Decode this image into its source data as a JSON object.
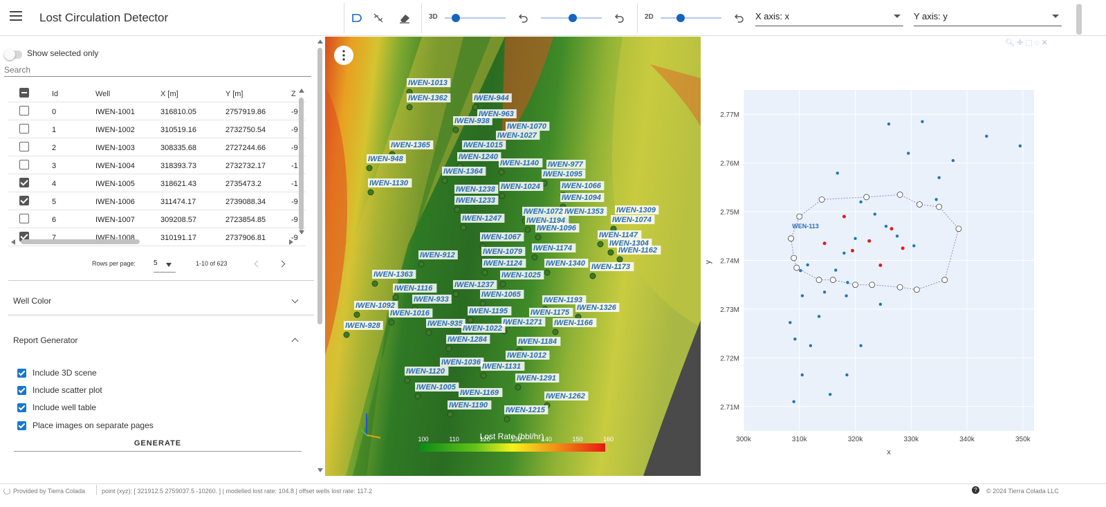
{
  "app": {
    "title": "Lost Circulation Detector"
  },
  "toolbar": {
    "label_3d": "3D",
    "label_2d": "2D",
    "slider_3d_a": 0.18,
    "slider_3d_b": 0.52,
    "slider_2d": 0.33,
    "x_axis": "X axis: x",
    "y_axis": "Y axis: y"
  },
  "sidebar": {
    "show_selected_label": "Show selected only",
    "search_placeholder": "Search",
    "columns": [
      "Id",
      "Well",
      "X [m]",
      "Y [m]",
      "Z"
    ],
    "rows": [
      {
        "id": "0",
        "well": "IWEN-1001",
        "x": "316810.05",
        "y": "2757919.86",
        "z": "-9",
        "sel": false
      },
      {
        "id": "1",
        "well": "IWEN-1002",
        "x": "310519.16",
        "y": "2732750.54",
        "z": "-9",
        "sel": false
      },
      {
        "id": "2",
        "well": "IWEN-1003",
        "x": "308335.68",
        "y": "2727244.66",
        "z": "-9",
        "sel": false
      },
      {
        "id": "3",
        "well": "IWEN-1004",
        "x": "318393.73",
        "y": "2732732.17",
        "z": "-1",
        "sel": false
      },
      {
        "id": "4",
        "well": "IWEN-1005",
        "x": "318621.43",
        "y": "2735473.2",
        "z": "-1",
        "sel": true
      },
      {
        "id": "5",
        "well": "IWEN-1006",
        "x": "311474.17",
        "y": "2739088.34",
        "z": "-9",
        "sel": true
      },
      {
        "id": "6",
        "well": "IWEN-1007",
        "x": "309208.57",
        "y": "2723854.85",
        "z": "-9",
        "sel": false
      },
      {
        "id": "7",
        "well": "IWEN-1008",
        "x": "310191.17",
        "y": "2737906.81",
        "z": "-9",
        "sel": true
      }
    ],
    "rows_per_page_label": "Rows per page:",
    "rows_per_page": "5",
    "range": "1-10 of 623",
    "well_color": "Well Color",
    "report_title": "Report Generator",
    "options": [
      "Include 3D scene",
      "Include scatter plot",
      "Include well table",
      "Place images on separate pages"
    ],
    "generate": "GENERATE"
  },
  "viewer": {
    "colorbar_title": "Lost Rate (bbl/hr)",
    "colorbar_ticks": [
      "100",
      "110",
      "120",
      "130",
      "140",
      "150",
      "160"
    ],
    "labels": [
      [
        "IWEN-1013",
        588,
        119
      ],
      [
        "IWEN-1362",
        588,
        141
      ],
      [
        "IWEN-944",
        683,
        141
      ],
      [
        "IWEN-963",
        690,
        164
      ],
      [
        "IWEN-938",
        655,
        174
      ],
      [
        "IWEN-1070",
        731,
        182
      ],
      [
        "IWEN-1027",
        717,
        195
      ],
      [
        "IWEN-1365",
        563,
        209
      ],
      [
        "IWEN-1015",
        668,
        209
      ],
      [
        "IWEN-948",
        530,
        229
      ],
      [
        "IWEN-1240",
        661,
        226
      ],
      [
        "IWEN-1140",
        721,
        235
      ],
      [
        "IWEN-977",
        790,
        237
      ],
      [
        "IWEN-1364",
        639,
        247
      ],
      [
        "IWEN-1095",
        783,
        251
      ],
      [
        "IWEN-1130",
        532,
        264
      ],
      [
        "IWEN-1024",
        722,
        269
      ],
      [
        "IWEN-1066",
        810,
        268
      ],
      [
        "IWEN-1238",
        657,
        273
      ],
      [
        "IWEN-1094",
        810,
        285
      ],
      [
        "IWEN-1233",
        657,
        289
      ],
      [
        "IWEN-1072",
        755,
        305
      ],
      [
        "IWEN-1353",
        814,
        305
      ],
      [
        "IWEN-1309",
        889,
        303
      ],
      [
        "IWEN-1247",
        666,
        315
      ],
      [
        "IWEN-1194",
        759,
        318
      ],
      [
        "IWEN-1074",
        883,
        317
      ],
      [
        "IWEN-1096",
        774,
        329
      ],
      [
        "IWEN-1147",
        864,
        339
      ],
      [
        "IWEN-1067",
        694,
        342
      ],
      [
        "IWEN-1304",
        879,
        351
      ],
      [
        "IWEN-1174",
        769,
        358
      ],
      [
        "IWEN-1162",
        892,
        361
      ],
      [
        "IWEN-1079",
        696,
        363
      ],
      [
        "IWEN-912",
        605,
        368
      ],
      [
        "IWEN-1124",
        697,
        380
      ],
      [
        "IWEN-1340",
        787,
        380
      ],
      [
        "IWEN-1173",
        853,
        385
      ],
      [
        "IWEN-1363",
        538,
        396
      ],
      [
        "IWEN-1025",
        723,
        397
      ],
      [
        "IWEN-1237",
        655,
        411
      ],
      [
        "IWEN-1116",
        568,
        416
      ],
      [
        "IWEN-1065",
        694,
        425
      ],
      [
        "IWEN-933",
        596,
        432
      ],
      [
        "IWEN-1193",
        784,
        433
      ],
      [
        "IWEN-1092",
        512,
        441
      ],
      [
        "IWEN-1326",
        832,
        444
      ],
      [
        "IWEN-1195",
        676,
        449
      ],
      [
        "IWEN-1016",
        562,
        452
      ],
      [
        "IWEN-1175",
        765,
        451
      ],
      [
        "IWEN-1271",
        725,
        465
      ],
      [
        "IWEN-935",
        616,
        467
      ],
      [
        "IWEN-1166",
        799,
        466
      ],
      [
        "IWEN-928",
        497,
        470
      ],
      [
        "IWEN-1022",
        667,
        474
      ],
      [
        "IWEN-1284",
        645,
        490
      ],
      [
        "IWEN-1184",
        747,
        493
      ],
      [
        "IWEN-1012",
        731,
        513
      ],
      [
        "IWEN-1036",
        636,
        523
      ],
      [
        "IWEN-1131",
        695,
        529
      ],
      [
        "IWEN-1120",
        585,
        536
      ],
      [
        "IWEN-1291",
        745,
        546
      ],
      [
        "IWEN-1005",
        600,
        559
      ],
      [
        "IWEN-1169",
        663,
        567
      ],
      [
        "IWEN-1262",
        787,
        572
      ],
      [
        "IWEN-1190",
        647,
        585
      ],
      [
        "IWEN-1215",
        729,
        592
      ]
    ]
  },
  "chart_data": {
    "type": "scatter",
    "xlabel": "x",
    "ylabel": "y",
    "xlim": [
      300000,
      352000
    ],
    "ylim": [
      2705000,
      2775000
    ],
    "xticks": [
      "300k",
      "310k",
      "320k",
      "330k",
      "340k",
      "350k"
    ],
    "yticks": [
      "2.71M",
      "2.72M",
      "2.73M",
      "2.74M",
      "2.75M",
      "2.76M",
      "2.77M"
    ],
    "series": [
      {
        "color": "#1f77b4",
        "values": [
          [
            316810,
            2757920
          ],
          [
            310519,
            2732751
          ],
          [
            308336,
            2727245
          ],
          [
            318394,
            2732732
          ],
          [
            318621,
            2735473
          ],
          [
            311474,
            2739088
          ],
          [
            309209,
            2723855
          ],
          [
            310191,
            2737907
          ],
          [
            326000,
            2768000
          ],
          [
            332000,
            2768500
          ],
          [
            329500,
            2762000
          ],
          [
            335000,
            2757000
          ],
          [
            321000,
            2752000
          ],
          [
            323500,
            2749500
          ],
          [
            325500,
            2747000
          ],
          [
            327500,
            2745000
          ],
          [
            330500,
            2743000
          ],
          [
            320000,
            2744500
          ],
          [
            318000,
            2741500
          ],
          [
            316500,
            2738000
          ],
          [
            314500,
            2733500
          ],
          [
            313500,
            2728500
          ],
          [
            312000,
            2722500
          ],
          [
            310500,
            2716500
          ],
          [
            309000,
            2711000
          ],
          [
            315500,
            2712500
          ],
          [
            318500,
            2716500
          ],
          [
            321000,
            2722500
          ],
          [
            324500,
            2731000
          ],
          [
            334500,
            2752500
          ],
          [
            337500,
            2760500
          ],
          [
            343500,
            2765500
          ],
          [
            349500,
            2763500
          ]
        ]
      },
      {
        "color": "#e41a1c",
        "values": [
          [
            319500,
            2742000
          ],
          [
            322500,
            2744000
          ],
          [
            326500,
            2746500
          ],
          [
            328500,
            2742500
          ],
          [
            314500,
            2743500
          ],
          [
            318000,
            2749000
          ],
          [
            324500,
            2739000
          ]
        ]
      }
    ],
    "polygon": [
      [
        308500,
        2744500
      ],
      [
        309000,
        2740500
      ],
      [
        309500,
        2738500
      ],
      [
        313500,
        2736000
      ],
      [
        316000,
        2736000
      ],
      [
        320000,
        2735000
      ],
      [
        323000,
        2735000
      ],
      [
        328000,
        2734500
      ],
      [
        331000,
        2734000
      ],
      [
        336000,
        2736000
      ],
      [
        338500,
        2746500
      ],
      [
        335000,
        2751000
      ],
      [
        331500,
        2751500
      ],
      [
        328000,
        2753500
      ],
      [
        322000,
        2753000
      ],
      [
        314000,
        2752500
      ],
      [
        310000,
        2749000
      ],
      [
        308500,
        2744500
      ]
    ],
    "polygon_label": "WEN-113"
  },
  "footer": {
    "provided": "Provided by Tierra Colada",
    "status": "point (xyz): [ 321912.5 2759037.5 -10260. ] | modelled lost rate: 104.8 | offset wells lost rate: 117.2",
    "copyright": "© 2024 Tierra Colada LLC"
  }
}
